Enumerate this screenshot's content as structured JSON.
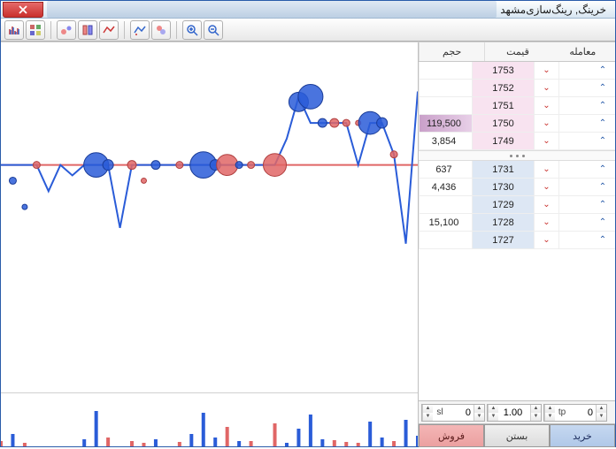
{
  "window": {
    "title": "خرینگ, رینگ‌سازی‌مشهد"
  },
  "toolbar": {
    "icons": [
      "chart-bars",
      "chart-group",
      "chart-bubble",
      "chart-switch",
      "chart-line",
      "reset",
      "filter",
      "color",
      "zoom-in",
      "zoom-out"
    ]
  },
  "order_header": {
    "vol": "حجم",
    "price": "قیمت",
    "trade": "معامله"
  },
  "asks": [
    {
      "vol": "",
      "price": "1753"
    },
    {
      "vol": "",
      "price": "1752"
    },
    {
      "vol": "",
      "price": "1751"
    },
    {
      "vol": "119,500",
      "price": "1750",
      "highlight": true
    },
    {
      "vol": "3,854",
      "price": "1749"
    }
  ],
  "bids": [
    {
      "vol": "637",
      "price": "1731"
    },
    {
      "vol": "4,436",
      "price": "1730"
    },
    {
      "vol": "",
      "price": "1729"
    },
    {
      "vol": "15,100",
      "price": "1728"
    },
    {
      "vol": "",
      "price": "1727"
    }
  ],
  "spinners": {
    "sl": {
      "label": "sl",
      "value": "0"
    },
    "qty": {
      "value": "1.00"
    },
    "tp": {
      "label": "tp",
      "value": "0"
    }
  },
  "actions": {
    "sell": "فروش",
    "close": "بستن",
    "buy": "خرید"
  },
  "chart_data": {
    "type": "line",
    "title": "",
    "xlabel": "",
    "ylabel": "",
    "y_range": [
      1700,
      1760
    ],
    "price_line": [
      1740,
      1740,
      1740,
      1740,
      1735,
      1740,
      1738,
      1740,
      1740,
      1740,
      1728,
      1740,
      1740,
      1740,
      1740,
      1740,
      1740,
      1740,
      1740,
      1740,
      1740,
      1740,
      1740,
      1740,
      1745,
      1753,
      1748,
      1748,
      1748,
      1748,
      1740,
      1748,
      1748,
      1742,
      1725,
      1754
    ],
    "bubbles": [
      {
        "i": 1,
        "y": 1737,
        "r": 4,
        "c": "blue"
      },
      {
        "i": 2,
        "y": 1732,
        "r": 3,
        "c": "blue"
      },
      {
        "i": 3,
        "y": 1740,
        "r": 4,
        "c": "red"
      },
      {
        "i": 8,
        "y": 1740,
        "r": 14,
        "c": "blue"
      },
      {
        "i": 9,
        "y": 1740,
        "r": 6,
        "c": "blue"
      },
      {
        "i": 11,
        "y": 1740,
        "r": 5,
        "c": "red"
      },
      {
        "i": 12,
        "y": 1737,
        "r": 3,
        "c": "red"
      },
      {
        "i": 13,
        "y": 1740,
        "r": 5,
        "c": "blue"
      },
      {
        "i": 15,
        "y": 1740,
        "r": 4,
        "c": "red"
      },
      {
        "i": 17,
        "y": 1740,
        "r": 15,
        "c": "blue"
      },
      {
        "i": 18,
        "y": 1740,
        "r": 6,
        "c": "blue"
      },
      {
        "i": 19,
        "y": 1740,
        "r": 12,
        "c": "red"
      },
      {
        "i": 20,
        "y": 1740,
        "r": 4,
        "c": "blue"
      },
      {
        "i": 21,
        "y": 1740,
        "r": 4,
        "c": "red"
      },
      {
        "i": 23,
        "y": 1740,
        "r": 13,
        "c": "red"
      },
      {
        "i": 25,
        "y": 1752,
        "r": 11,
        "c": "blue"
      },
      {
        "i": 26,
        "y": 1753,
        "r": 14,
        "c": "blue"
      },
      {
        "i": 27,
        "y": 1748,
        "r": 5,
        "c": "blue"
      },
      {
        "i": 28,
        "y": 1748,
        "r": 5,
        "c": "red"
      },
      {
        "i": 29,
        "y": 1748,
        "r": 4,
        "c": "red"
      },
      {
        "i": 30,
        "y": 1748,
        "r": 3,
        "c": "red"
      },
      {
        "i": 31,
        "y": 1748,
        "r": 13,
        "c": "blue"
      },
      {
        "i": 32,
        "y": 1748,
        "r": 6,
        "c": "blue"
      },
      {
        "i": 33,
        "y": 1742,
        "r": 4,
        "c": "red"
      }
    ],
    "volume_bars": [
      {
        "i": 0,
        "h": 6,
        "c": "red"
      },
      {
        "i": 1,
        "h": 14,
        "c": "blue"
      },
      {
        "i": 2,
        "h": 4,
        "c": "red"
      },
      {
        "i": 7,
        "h": 8,
        "c": "blue"
      },
      {
        "i": 8,
        "h": 40,
        "c": "blue"
      },
      {
        "i": 9,
        "h": 10,
        "c": "red"
      },
      {
        "i": 11,
        "h": 6,
        "c": "red"
      },
      {
        "i": 12,
        "h": 4,
        "c": "red"
      },
      {
        "i": 13,
        "h": 8,
        "c": "blue"
      },
      {
        "i": 15,
        "h": 5,
        "c": "red"
      },
      {
        "i": 16,
        "h": 14,
        "c": "blue"
      },
      {
        "i": 17,
        "h": 38,
        "c": "blue"
      },
      {
        "i": 18,
        "h": 10,
        "c": "blue"
      },
      {
        "i": 19,
        "h": 22,
        "c": "red"
      },
      {
        "i": 20,
        "h": 6,
        "c": "blue"
      },
      {
        "i": 21,
        "h": 6,
        "c": "red"
      },
      {
        "i": 23,
        "h": 26,
        "c": "red"
      },
      {
        "i": 24,
        "h": 4,
        "c": "blue"
      },
      {
        "i": 25,
        "h": 20,
        "c": "blue"
      },
      {
        "i": 26,
        "h": 36,
        "c": "blue"
      },
      {
        "i": 27,
        "h": 8,
        "c": "blue"
      },
      {
        "i": 28,
        "h": 7,
        "c": "red"
      },
      {
        "i": 29,
        "h": 5,
        "c": "red"
      },
      {
        "i": 30,
        "h": 4,
        "c": "red"
      },
      {
        "i": 31,
        "h": 28,
        "c": "blue"
      },
      {
        "i": 32,
        "h": 10,
        "c": "blue"
      },
      {
        "i": 33,
        "h": 6,
        "c": "red"
      },
      {
        "i": 34,
        "h": 30,
        "c": "blue"
      },
      {
        "i": 35,
        "h": 12,
        "c": "blue"
      }
    ]
  }
}
